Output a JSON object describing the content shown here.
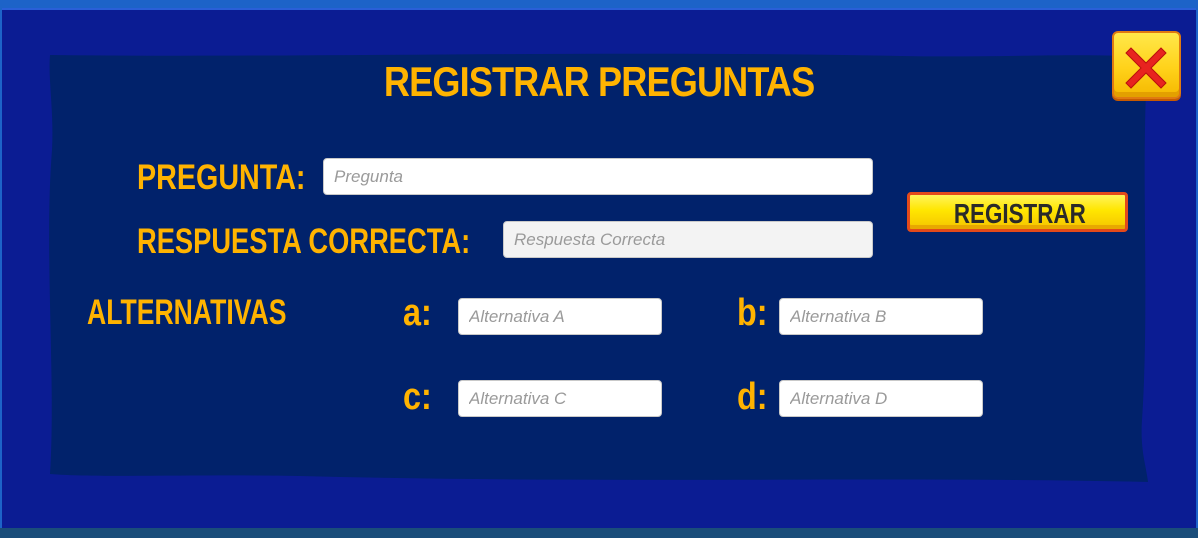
{
  "screen": {
    "title": "REGISTRAR PREGUNTAS"
  },
  "form": {
    "pregunta_label": "PREGUNTA:",
    "pregunta_placeholder": "Pregunta",
    "respuesta_label": "RESPUESTA CORRECTA:",
    "respuesta_placeholder": "Respuesta Correcta",
    "alternativas_label": "ALTERNATIVAS",
    "alternatives": [
      {
        "letter": "a:",
        "placeholder": "Alternativa A"
      },
      {
        "letter": "b:",
        "placeholder": "Alternativa B"
      },
      {
        "letter": "c:",
        "placeholder": "Alternativa C"
      },
      {
        "letter": "d:",
        "placeholder": "Alternativa D"
      }
    ]
  },
  "buttons": {
    "register_label": "REGISTRAR",
    "close_icon": "close-x-icon"
  },
  "colors": {
    "label_orange": "#ffb300",
    "panel_blue": "#0b1c93",
    "inner_navy": "#01226b",
    "close_red": "#e8231f",
    "button_yellow": "#ffe600"
  }
}
